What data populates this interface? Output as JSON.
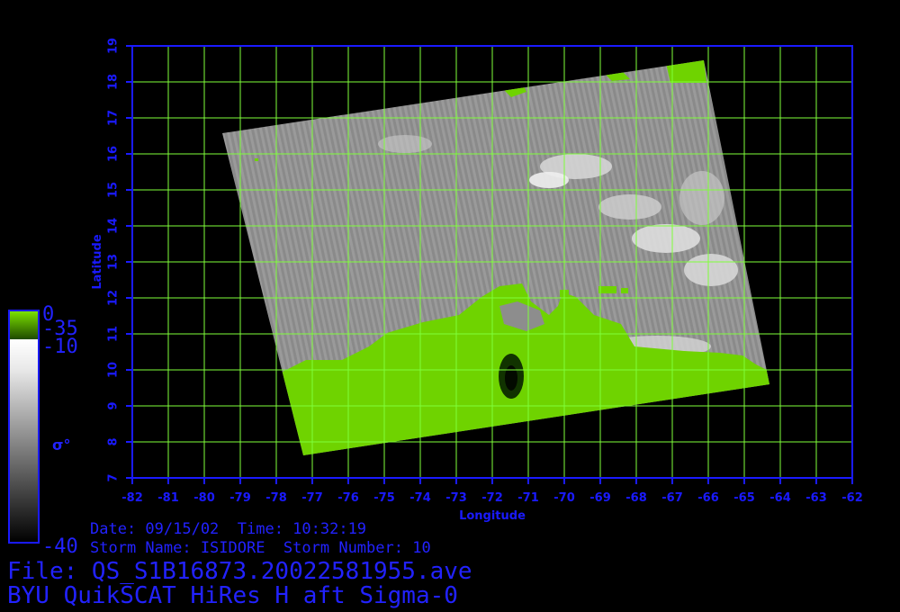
{
  "map": {
    "x_axis_label": "Longitude",
    "y_axis_label": "Latitude",
    "lon_range": [
      -82,
      -62
    ],
    "lat_range": [
      7,
      19
    ],
    "lon_ticks": [
      "-82",
      "-81",
      "-80",
      "-79",
      "-78",
      "-77",
      "-76",
      "-75",
      "-74",
      "-73",
      "-72",
      "-71",
      "-70",
      "-69",
      "-68",
      "-67",
      "-66",
      "-65",
      "-64",
      "-63",
      "-62"
    ],
    "lat_ticks": [
      "7",
      "8",
      "9",
      "10",
      "11",
      "12",
      "13",
      "14",
      "15",
      "16",
      "17",
      "18",
      "19"
    ],
    "grid": true,
    "colors": {
      "axis": "#1a1aff",
      "grid": "#7fff3a",
      "land": "#6fd300",
      "background": "#000000"
    }
  },
  "colorbar": {
    "land_top": "0",
    "land_bottom": "-35",
    "scale_top": "-10",
    "symbol": "σ°",
    "scale_bottom": "-40"
  },
  "info": {
    "date_line": "Date: 09/15/02  Time: 10:32:19",
    "storm_line": "Storm Name: ISIDORE  Storm Number: 10",
    "file_line": "File: QS_S1B16873.20022581955.ave",
    "title_line": "BYU QuikSCAT HiRes H aft Sigma-0"
  }
}
